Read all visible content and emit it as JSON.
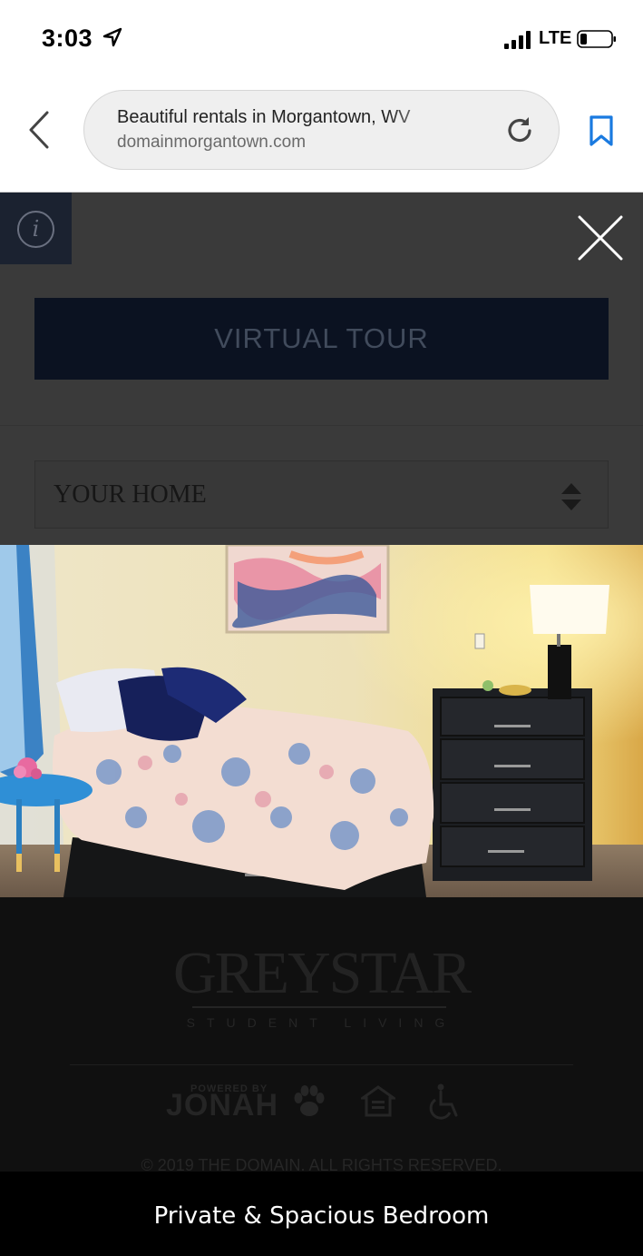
{
  "status_bar": {
    "time": "3:03",
    "network": "LTE",
    "icons": [
      "location-arrow-icon",
      "signal-bars-icon",
      "battery-icon"
    ]
  },
  "browser": {
    "page_title": "Beautiful rentals in Morgantown, WV",
    "domain": "domainmorgantown.com",
    "icons": [
      "back-chevron-icon",
      "reload-icon",
      "bookmark-icon"
    ],
    "accent_color": "#1a7ae0"
  },
  "page": {
    "info_icon": "info-icon",
    "close_icon": "close-icon",
    "virtual_tour_label": "VIRTUAL TOUR",
    "home_select_value": "YOUR HOME"
  },
  "footer": {
    "brand": "GREYSTAR",
    "brand_sub": "STUDENT LIVING",
    "powered_by": "POWERED BY",
    "jonah": "JONAH",
    "icons": [
      "paw-icon",
      "equal-housing-icon",
      "accessibility-icon"
    ],
    "copyright": "© 2019 THE DOMAIN. ALL RIGHTS RESERVED."
  },
  "lightbox": {
    "caption": "Private & Spacious Bedroom"
  }
}
